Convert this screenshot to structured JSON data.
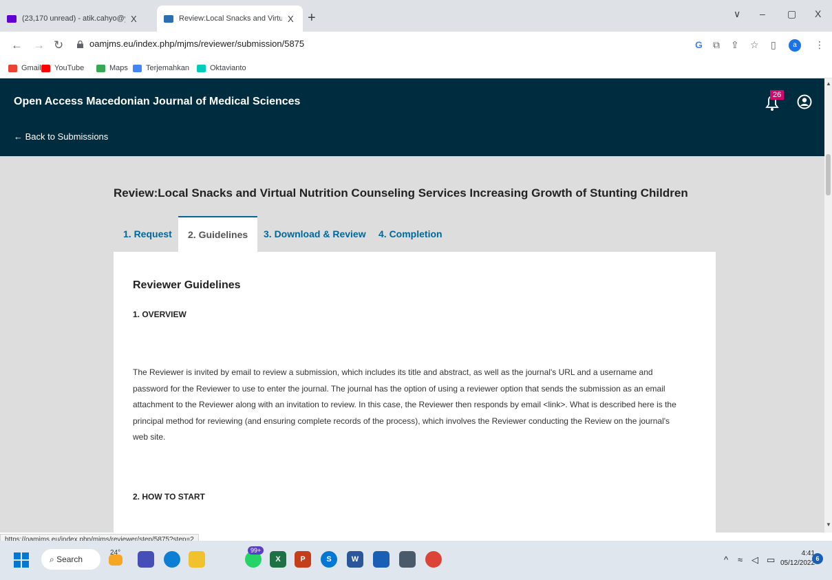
{
  "browser": {
    "tabs": [
      {
        "title": "(23,170 unread) - atik.cahyo@ya",
        "close": "X"
      },
      {
        "title": "Review:Local Snacks and Virtual N",
        "close": "X"
      }
    ],
    "new_tab": "+",
    "window_controls": {
      "menu": "∨",
      "minimize": "–",
      "restore": "▢",
      "close": "X"
    },
    "address": "oamjms.eu/index.php/mjms/reviewer/submission/5875",
    "profile_letter": "a",
    "bookmarks": [
      "Gmail",
      "YouTube",
      "Maps",
      "Terjemahkan",
      "Oktavianto"
    ],
    "status_url": "https://oamjms.eu/index.php/mjms/reviewer/step/5875?step=2"
  },
  "site": {
    "title": "Open Access Macedonian Journal of Medical Sciences",
    "back_link": "← Back to Submissions",
    "notification_count": "26"
  },
  "review": {
    "title": "Review:Local Snacks and Virtual Nutrition Counseling Services Increasing Growth of Stunting Children",
    "tabs": [
      "1. Request",
      "2. Guidelines",
      "3. Download & Review",
      "4. Completion"
    ],
    "active_tab": "2. Guidelines",
    "heading": "Reviewer Guidelines",
    "section1": "1. OVERVIEW",
    "para_lines": [
      "The Reviewer is invited by email to review a submission, which includes its title and abstract, as well as the journal's URL and a username and",
      "password for the Reviewer to use to enter the journal. The journal has the option of using a reviewer option that sends the submission as an email",
      "attachment to the Reviewer along with an invitation to review. In this case, the Reviewer then responds by email <link>. What is described here is the",
      "principal method for reviewing (and ensuring complete records of the process), which involves the Reviewer conducting the Review on the journal's",
      "web site."
    ],
    "section2": "2. HOW TO START"
  },
  "taskbar": {
    "search": "Search",
    "weather": "24°",
    "badge": "99+",
    "time": "4:41",
    "date": "05/12/2022",
    "notifications": "6"
  },
  "colors": {
    "header": "#002c40",
    "link": "#006798",
    "badge": "#d00a6c"
  }
}
